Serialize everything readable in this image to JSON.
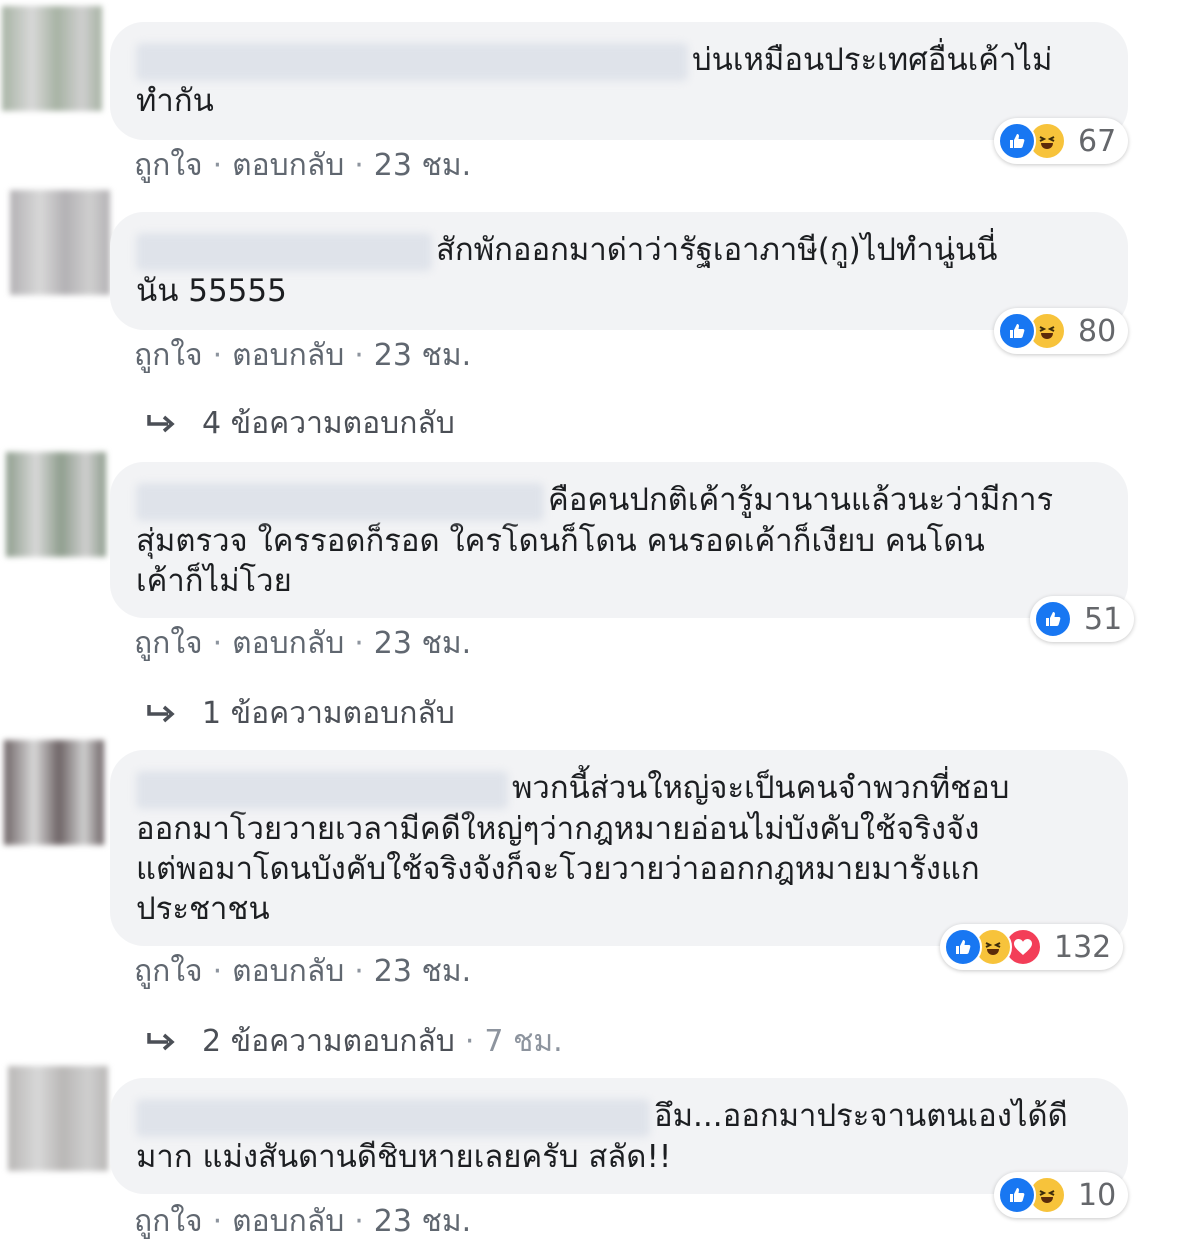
{
  "colors": {
    "like": "#1877f2",
    "haha": "#f7c33b",
    "love": "#f33e58",
    "bubble": "#f2f3f5",
    "meta": "#606770"
  },
  "comments": [
    {
      "text": "บ่นเหมือนประเทศอื่นเค้าไม่\nทำกัน",
      "reactions": [
        "like-icon",
        "haha-icon"
      ],
      "count": "67",
      "like_label": "ถูกใจ",
      "reply_label": "ตอบกลับ",
      "time": "23 ชม.",
      "avatar_color": "#a7b3a4"
    },
    {
      "text": "สักพักออกมาด่าว่ารัฐเอาภาษี(กู)ไปทำนู่นนี่\nนัน 55555",
      "reactions": [
        "like-icon",
        "haha-icon"
      ],
      "count": "80",
      "like_label": "ถูกใจ",
      "reply_label": "ตอบกลับ",
      "time": "23 ชม.",
      "avatar_color": "#b3b1b4",
      "replies": {
        "label": "4 ข้อความตอบกลับ"
      }
    },
    {
      "text": "คือคนปกติเค้ารู้มานานแล้วนะว่ามีการ\nสุ่มตรวจ ใครรอดก็รอด ใครโดนก็โดน คนรอดเค้าก็เงียบ คนโดน\nเค้าก็ไม่โวย",
      "reactions": [
        "like-icon"
      ],
      "count": "51",
      "like_label": "ถูกใจ",
      "reply_label": "ตอบกลับ",
      "time": "23 ชม.",
      "avatar_color": "#8f9e8e",
      "replies": {
        "label": "1 ข้อความตอบกลับ"
      }
    },
    {
      "text": "พวกนี้ส่วนใหญ่จะเป็นคนจำพวกที่ชอบ\nออกมาโวยวายเวลามีคดีใหญ่ๆว่ากฎหมายอ่อนไม่บังคับใช้จริงจัง\nแต่พอมาโดนบังคับใช้จริงจังก็จะโวยวายว่าออกกฎหมายมารังแก\nประชาชน",
      "reactions": [
        "like-icon",
        "haha-icon",
        "love-icon"
      ],
      "count": "132",
      "like_label": "ถูกใจ",
      "reply_label": "ตอบกลับ",
      "time": "23 ชม.",
      "avatar_color": "#6e6466",
      "replies": {
        "label": "2 ข้อความตอบกลับ",
        "time": "7 ชม."
      }
    },
    {
      "text": "อึม...ออกมาประจานตนเองได้ดี\nมาก แม่งสันดานดีชิบหายเลยครับ สลัด!!",
      "reactions": [
        "like-icon",
        "haha-icon"
      ],
      "count": "10",
      "like_label": "ถูกใจ",
      "reply_label": "ตอบกลับ",
      "time": "23 ชม.",
      "avatar_color": "#b9b7b6"
    }
  ]
}
